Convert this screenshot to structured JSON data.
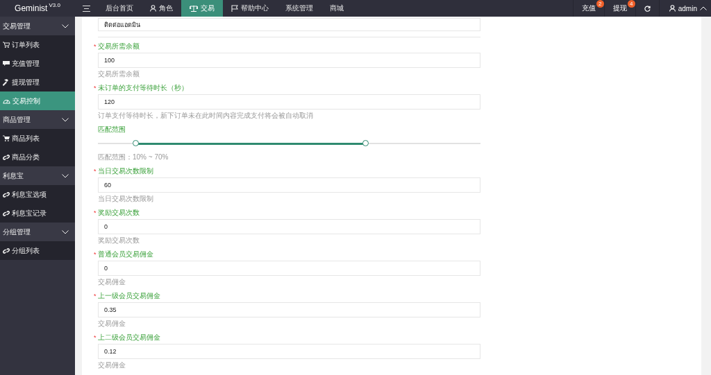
{
  "app": {
    "name": "Geminist",
    "version": "V3.0"
  },
  "topnav": {
    "items": [
      {
        "label": "后台首页",
        "selected": false
      },
      {
        "label": "角色",
        "selected": false
      },
      {
        "label": "交易",
        "selected": true
      },
      {
        "label": "帮助中心",
        "selected": false
      },
      {
        "label": "系统管理",
        "selected": false
      },
      {
        "label": "商城",
        "selected": false
      }
    ],
    "actions": [
      {
        "label": "充值",
        "badge": "2"
      },
      {
        "label": "提现",
        "badge": "4"
      }
    ],
    "user": {
      "name": "admin"
    }
  },
  "sidebar": {
    "groups": [
      {
        "title": "交易管理",
        "expanded": true,
        "items": [
          {
            "label": "订单列表",
            "selected": false
          },
          {
            "label": "充值管理",
            "selected": false
          },
          {
            "label": "提现管理",
            "selected": false
          },
          {
            "label": "交易控制",
            "selected": true
          }
        ]
      },
      {
        "title": "商品管理",
        "expanded": true,
        "items": [
          {
            "label": "商品列表",
            "selected": false
          },
          {
            "label": "商品分类",
            "selected": false
          }
        ]
      },
      {
        "title": "利息宝",
        "expanded": true,
        "items": [
          {
            "label": "利息宝选项",
            "selected": false
          },
          {
            "label": "利息宝记录",
            "selected": false
          }
        ]
      },
      {
        "title": "分组管理",
        "expanded": true,
        "items": [
          {
            "label": "分组列表",
            "selected": false
          }
        ]
      }
    ]
  },
  "form": {
    "fields": [
      {
        "kind": "text",
        "value": "ติดต่อแอดมิน"
      },
      {
        "kind": "text",
        "required_mark": "*",
        "label": "交易所需余额",
        "value": "100",
        "hint": "交易所需余额"
      },
      {
        "kind": "text",
        "required_mark": "*",
        "label": "未订单的支付等待时长（秒）",
        "value": "120",
        "hint": "订单支付等待时长，新下订单未在此时间内容完成支付将会被自动取消"
      },
      {
        "kind": "range",
        "label": "匹配范围",
        "thumbs": [
          {
            "level": 0.1
          },
          {
            "level": 0.7
          }
        ],
        "hint": "匹配范围：10% ~ 70%"
      },
      {
        "kind": "text",
        "required_mark": "*",
        "label": "当日交易次数限制",
        "value": "60",
        "hint": "当日交易次数限制"
      },
      {
        "kind": "text",
        "required_mark": "*",
        "label": "奖励交易次数",
        "value": "0",
        "hint": "奖励交易次数"
      },
      {
        "kind": "text",
        "required_mark": "*",
        "label": "普通会员交易佣金",
        "value": "0",
        "hint": "交易佣金"
      },
      {
        "kind": "text",
        "required_mark": "*",
        "label": "上一级会员交易佣金",
        "value": "0.35",
        "hint": "交易佣金"
      },
      {
        "kind": "text",
        "required_mark": "*",
        "label": "上二级会员交易佣金",
        "value": "0.12",
        "hint": "交易佣金"
      }
    ]
  }
}
